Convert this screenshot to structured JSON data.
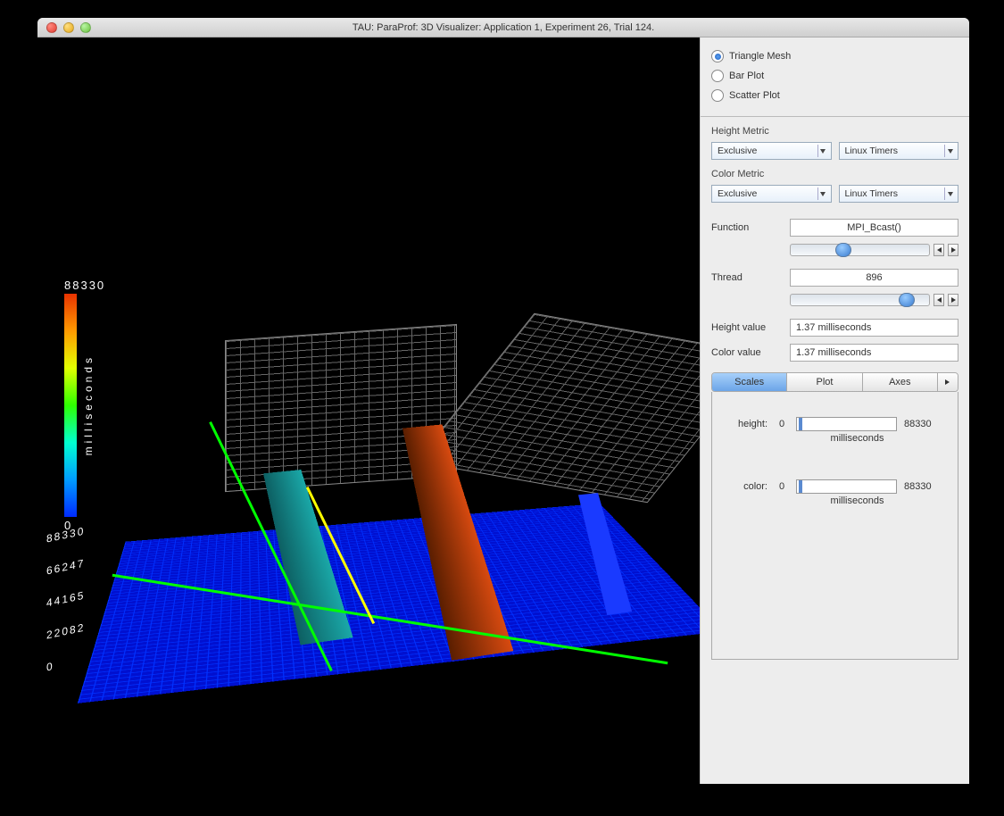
{
  "window": {
    "title": "TAU: ParaProf: 3D Visualizer: Application 1, Experiment 26, Trial 124."
  },
  "colorbar": {
    "max": "88330",
    "min": "0",
    "unit_label": "milliseconds"
  },
  "z_axis_ticks": [
    "88330",
    "66247",
    "44165",
    "22082",
    "0"
  ],
  "panel": {
    "plot_types": {
      "triangle": "Triangle Mesh",
      "bar": "Bar Plot",
      "scatter": "Scatter Plot"
    },
    "height_metric_label": "Height Metric",
    "color_metric_label": "Color Metric",
    "metric_type": "Exclusive",
    "metric_source": "Linux Timers",
    "function_label": "Function",
    "function_value": "MPI_Bcast()",
    "thread_label": "Thread",
    "thread_value": "896",
    "height_value_label": "Height value",
    "height_value": "1.37 milliseconds",
    "color_value_label": "Color value",
    "color_value": "1.37 milliseconds",
    "tabs": {
      "scales": "Scales",
      "plot": "Plot",
      "axes": "Axes"
    },
    "scales": {
      "height_label": "height:",
      "color_label": "color:",
      "min": "0",
      "max": "88330",
      "unit": "milliseconds"
    }
  }
}
